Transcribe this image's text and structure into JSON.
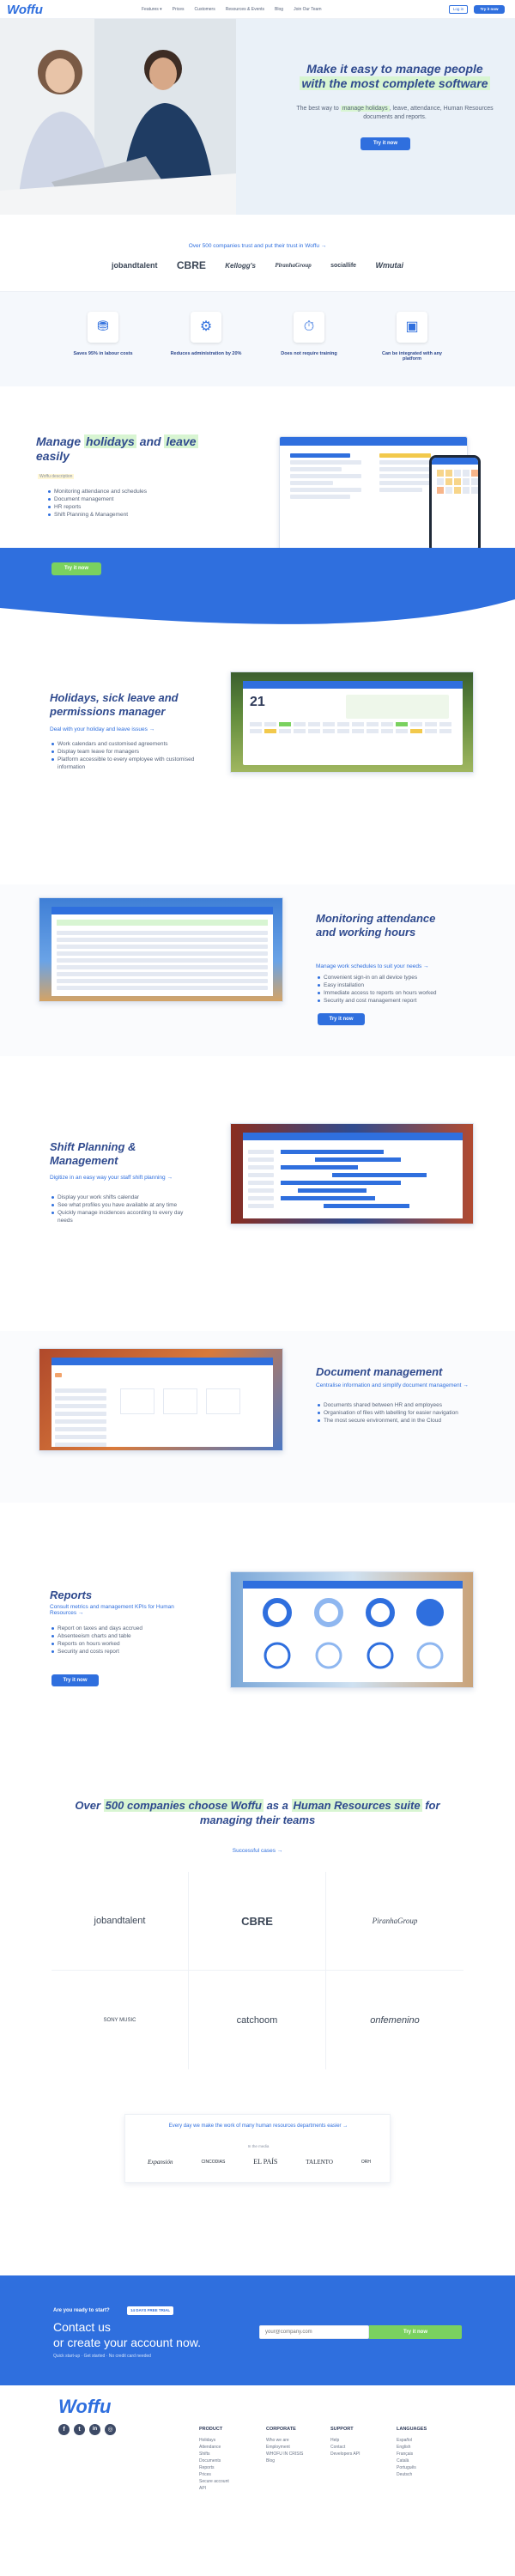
{
  "header": {
    "logo": "Woffu",
    "nav": [
      "Features ▾",
      "Prices",
      "Customers",
      "Resources & Events",
      "Blog",
      "Join Our Team"
    ],
    "login": "Log in",
    "try_btn": "Try it now"
  },
  "hero": {
    "title_line1": "Make it easy to manage people",
    "title_line2": "with the most complete software",
    "subtitle_pre": "The best way to ",
    "subtitle_hl": "manage holidays",
    "subtitle_post": ", leave, attendance, Human Resources documents and reports.",
    "cta": "Try it now"
  },
  "trust": {
    "title": "Over 500 companies trust and put their trust in Woffu →",
    "logos": [
      "jobandtalent",
      "CBRE",
      "Kellogg's",
      "PiranhaGroup",
      "sociallife",
      "Wmutai"
    ]
  },
  "benefits": [
    {
      "icon": "piggy-bank-icon",
      "label": "Saves 95% in labour costs"
    },
    {
      "icon": "gears-icon",
      "label": "Reduces administration by 20%"
    },
    {
      "icon": "stopwatch-icon",
      "label": "Does not require training"
    },
    {
      "icon": "integration-icon",
      "label": "Can be integrated with any platform"
    }
  ],
  "manage": {
    "title_a": "Manage ",
    "title_hl1": "holidays",
    "title_b": " and ",
    "title_hl2": "leave",
    "title_c": " easily",
    "tag": "Woffu description",
    "bullets": [
      "Monitoring attendance and schedules",
      "Document management",
      "HR reports",
      "Shift Planning & Management"
    ],
    "cta": "Try it now"
  },
  "sections": [
    {
      "title": "Holidays, sick leave and permissions manager",
      "link": "Deal with your holiday and leave issues →",
      "bullets": [
        "Work calendars and customised agreements",
        "Display team leave for managers",
        "Platform accessible to every employee with customised information"
      ]
    },
    {
      "title": "Monitoring attendance and working hours",
      "link": "Manage work schedules to suit your needs →",
      "bullets": [
        "Convenient sign-in on all device types",
        "Easy installation",
        "Immediate access to reports on hours worked",
        "Security and cost management report"
      ],
      "cta": "Try it now"
    },
    {
      "title": "Shift Planning & Management",
      "link": "Digitize in an easy way your staff shift planning →",
      "bullets": [
        "Display your work shifts calendar",
        "See what profiles you have available at any time",
        "Quickly manage incidences according to every day needs"
      ]
    },
    {
      "title": "Document management",
      "link": "Centralise information and simplify document management →",
      "bullets": [
        "Documents shared between HR and employees",
        "Organisation of files with labelling for easier navigation",
        "The most secure environment, and in the Cloud"
      ]
    },
    {
      "title": "Reports",
      "link": "Consult metrics and management KPIs for Human Resources →",
      "bullets": [
        "Report on taxes and days accrued",
        "Absenteeism charts and table",
        "Reports on hours worked",
        "Security and costs report"
      ],
      "cta": "Try it now"
    }
  ],
  "companies": {
    "title_a": "Over ",
    "title_hl1": "500 companies choose Woffu",
    "title_b": " as a ",
    "title_hl2": "Human Resources suite",
    "title_c": " for managing their teams",
    "link": "Successful cases →",
    "logos": [
      "jobandtalent",
      "CBRE",
      "PiranhaGroup",
      "SONY MUSIC",
      "catchoom",
      "onfemenino"
    ]
  },
  "press": {
    "title": "Every day we make the work of many human resources departments easier →",
    "sub": "In the media",
    "logos": [
      "Expansión",
      "CINCODIAS",
      "EL PAÍS",
      "TALENTO",
      "ORH"
    ]
  },
  "cta_band": {
    "question": "Are you ready to start?",
    "badge": "14 DAYS FREE TRIAL",
    "line1": "Contact us",
    "line2": "or create your account now.",
    "note": "Quick start-up · Get started · No credit card needed",
    "placeholder": "your@company.com",
    "button": "Try it now"
  },
  "footer": {
    "logo": "Woffu",
    "socials": [
      "facebook-icon",
      "twitter-icon",
      "linkedin-icon",
      "instagram-icon"
    ],
    "cols": [
      {
        "title": "PRODUCT",
        "items": [
          "Holidays",
          "Attendance",
          "Shifts",
          "Documents",
          "Reports",
          "Prices",
          "Secure account",
          "API"
        ]
      },
      {
        "title": "CORPORATE",
        "items": [
          "Who we are",
          "Employment",
          "WHOFU IN CRISIS",
          "Blog"
        ]
      },
      {
        "title": "SUPPORT",
        "items": [
          "Help",
          "Contact",
          "Developers API"
        ]
      },
      {
        "title": "LANGUAGES",
        "items": [
          "Español",
          "English",
          "Français",
          "Català",
          "Português",
          "Deutsch"
        ]
      }
    ]
  },
  "colors": {
    "brand": "#2f6fde",
    "highlight": "#d8f5d2",
    "cta_green": "#7ad15f",
    "title": "#2f4a8e"
  }
}
